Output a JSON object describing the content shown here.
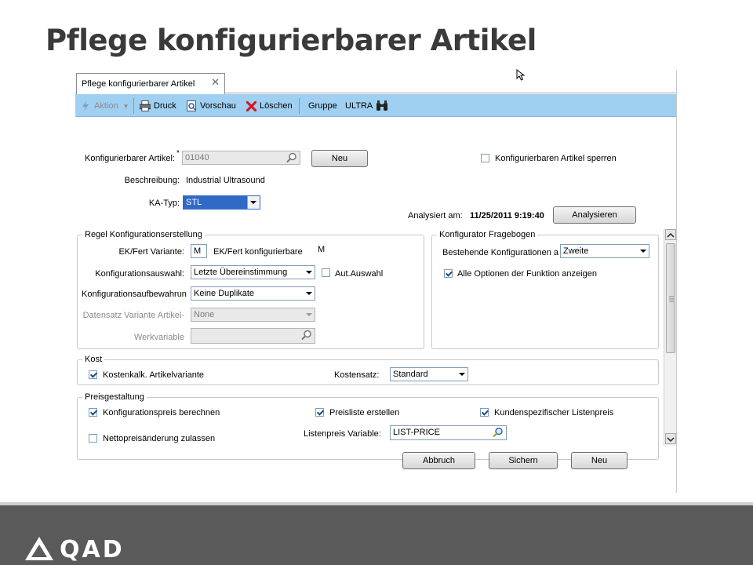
{
  "slide": {
    "title": "Pflege konfigurierbarer Artikel"
  },
  "tab": {
    "label": "Pflege konfigurierbarer Artikel",
    "close": "✕"
  },
  "toolbar": {
    "action": "Aktion",
    "print": "Druck",
    "preview": "Vorschau",
    "delete": "Löschen",
    "group_label": "Gruppe",
    "group_value": "ULTRA"
  },
  "header": {
    "item_label": "Konfigurierbarer Artikel:",
    "required_mark": "*",
    "item_value": "01040",
    "new_button": "Neu",
    "lock_label": "Konfigurierbaren Artikel sperren",
    "desc_label": "Beschreibung:",
    "desc_value": "Industrial Ultrasound",
    "ka_label": "KA-Typ:",
    "ka_value": "STL",
    "analyzed_label": "Analysiert am:",
    "analyzed_value": "11/25/2011 9:19:40",
    "analyze_button": "Analysieren"
  },
  "rules": {
    "title": "Regel Konfigurationserstellung",
    "ek_label": "EK/Fert Variante:",
    "ek_value": "M",
    "ek_text": "EK/Fert konfigurierbare",
    "ek_text_value": "M",
    "conf_sel_label": "Konfigurationsauswahl:",
    "conf_sel_value": "Letzte Übereinstimmung",
    "auto_label": "Aut.Auswahl",
    "conf_keep_label": "Konfigurationsaufbewahrun",
    "conf_keep_value": "Keine Duplikate",
    "dataset_label": "Datensatz Variante Artikel-",
    "dataset_value": "None",
    "work_label": "Werkvariable"
  },
  "questionnaire": {
    "title": "Konfigurator Fragebogen",
    "existing_label": "Bestehende Konfigurationen a",
    "existing_value": "Zweite",
    "all_options_label": "Alle Optionen der Funktion anzeigen"
  },
  "cost": {
    "title": "Kost",
    "calc_label": "Kostenkalk. Artikelvariante",
    "costset_label": "Kostensatz:",
    "costset_value": "Standard"
  },
  "pricing": {
    "title": "Preisgestaltung",
    "calc_label": "Konfigurationspreis berechnen",
    "pricelist_label": "Preisliste erstellen",
    "customer_label": "Kundenspezifischer Listenpreis",
    "net_label": "Nettopreisänderung zulassen",
    "listvar_label": "Listenpreis Variable:",
    "listvar_value": "LIST-PRICE"
  },
  "actions": {
    "cancel": "Abbruch",
    "save": "Sichern",
    "new": "Neu"
  },
  "brand": {
    "name": "QAD"
  },
  "colors": {
    "toolbar": "#9fd0f2",
    "selection": "#3169c6",
    "footer": "#5a5a5a"
  }
}
